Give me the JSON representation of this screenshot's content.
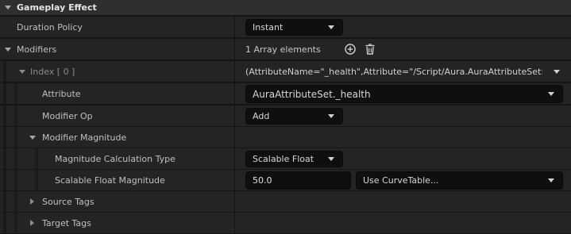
{
  "section": {
    "title": "Gameplay Effect"
  },
  "rows": {
    "duration": {
      "label": "Duration Policy",
      "value": "Instant"
    },
    "modifiers": {
      "label": "Modifiers",
      "count": "1 Array elements"
    },
    "index": {
      "label": "Index [ 0 ]",
      "summary": "(AttributeName=\"_health\",Attribute=\"/Script/Aura.AuraAttributeSet:_healt"
    },
    "attribute": {
      "label": "Attribute",
      "value": "AuraAttributeSet._health"
    },
    "modifier_op": {
      "label": "Modifier Op",
      "value": "Add"
    },
    "magnitude": {
      "label": "Modifier Magnitude"
    },
    "calc_type": {
      "label": "Magnitude Calculation Type",
      "value": "Scalable Float"
    },
    "scalable": {
      "label": "Scalable Float Magnitude",
      "value": "50.0",
      "curve": "Use CurveTable..."
    },
    "source_tags": {
      "label": "Source Tags"
    },
    "target_tags": {
      "label": "Target Tags"
    }
  }
}
